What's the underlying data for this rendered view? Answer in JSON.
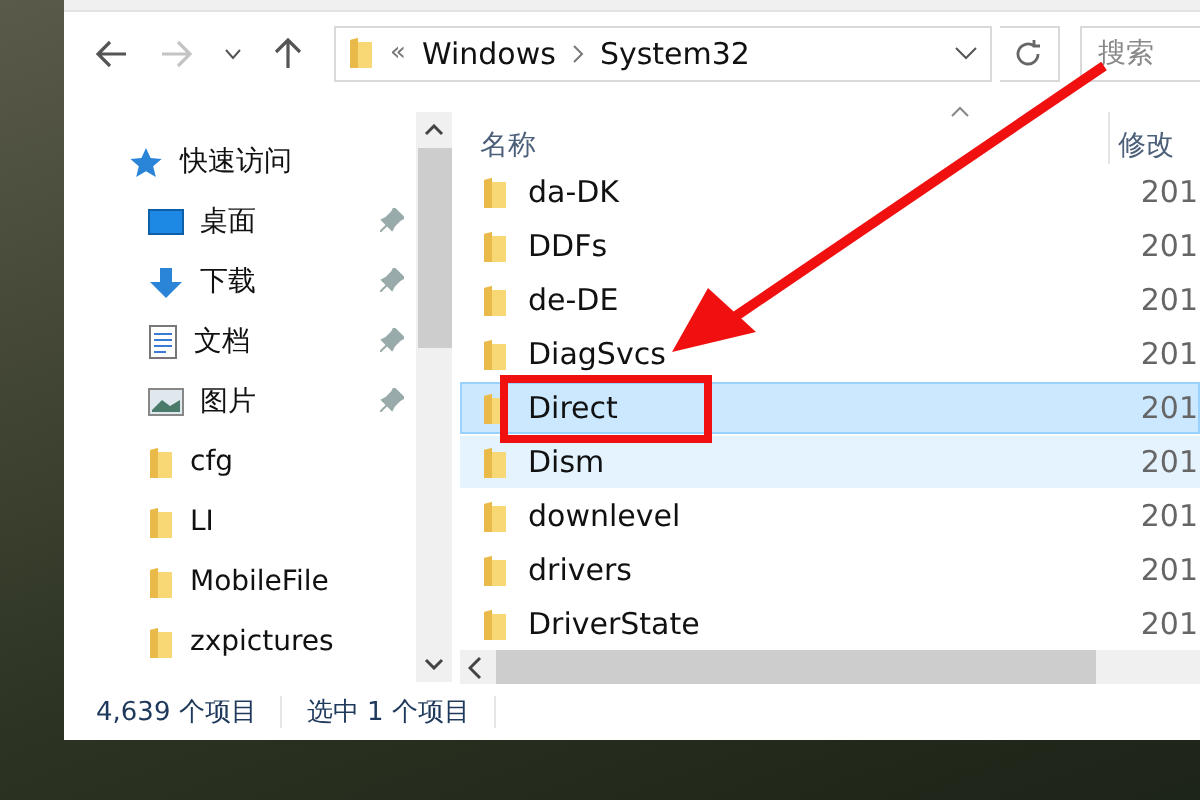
{
  "address_bar": {
    "overflow": "«",
    "path": [
      "Windows",
      "System32"
    ]
  },
  "search": {
    "placeholder": "搜索"
  },
  "sidebar": {
    "items": [
      {
        "label": "快速访问",
        "kind": "star",
        "pinned": false
      },
      {
        "label": "桌面",
        "kind": "desktop",
        "pinned": true
      },
      {
        "label": "下载",
        "kind": "download",
        "pinned": true
      },
      {
        "label": "文档",
        "kind": "document",
        "pinned": true
      },
      {
        "label": "图片",
        "kind": "picture",
        "pinned": true
      },
      {
        "label": "cfg",
        "kind": "folder",
        "pinned": false
      },
      {
        "label": "LI",
        "kind": "folder",
        "pinned": false
      },
      {
        "label": "MobileFile",
        "kind": "folder",
        "pinned": false
      },
      {
        "label": "zxpictures",
        "kind": "folder",
        "pinned": false
      }
    ]
  },
  "table": {
    "columns": [
      "名称",
      "修改"
    ],
    "rows": [
      {
        "name": "da-DK",
        "date": "201",
        "selected": false,
        "hovered": false
      },
      {
        "name": "DDFs",
        "date": "201",
        "selected": false,
        "hovered": false
      },
      {
        "name": "de-DE",
        "date": "201",
        "selected": false,
        "hovered": false
      },
      {
        "name": "DiagSvcs",
        "date": "201",
        "selected": false,
        "hovered": false
      },
      {
        "name": "Direct",
        "date": "201",
        "selected": true,
        "hovered": false
      },
      {
        "name": "Dism",
        "date": "201",
        "selected": false,
        "hovered": true
      },
      {
        "name": "downlevel",
        "date": "201",
        "selected": false,
        "hovered": false
      },
      {
        "name": "drivers",
        "date": "201",
        "selected": false,
        "hovered": false
      },
      {
        "name": "DriverState",
        "date": "201",
        "selected": false,
        "hovered": false
      }
    ]
  },
  "status_bar": {
    "count": "4,639 个项目",
    "selection": "选中 1 个项目"
  }
}
